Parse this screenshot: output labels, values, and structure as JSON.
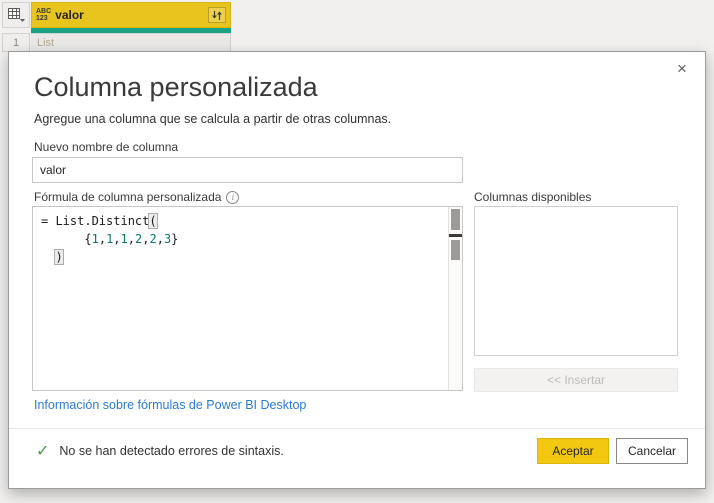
{
  "table": {
    "header": {
      "type_label_top": "ABC",
      "type_label_bottom": "123",
      "column_name": "valor"
    },
    "row": {
      "number": "1",
      "value": "List"
    }
  },
  "dialog": {
    "close_glyph": "×",
    "title": "Columna personalizada",
    "subtitle": "Agregue una columna que se calcula a partir de otras columnas.",
    "name_field": {
      "label": "Nuevo nombre de columna",
      "value": "valor"
    },
    "formula_field": {
      "label": "Fórmula de columna personalizada",
      "info_glyph": "i",
      "lines": [
        [
          {
            "t": "= ",
            "c": "p"
          },
          {
            "t": "List.Distinct",
            "c": "p"
          },
          {
            "t": "(",
            "c": "b"
          }
        ],
        [
          {
            "t": "      ",
            "c": "p"
          },
          {
            "t": "{",
            "c": "p"
          },
          {
            "t": "1",
            "c": "n"
          },
          {
            "t": ",",
            "c": "p"
          },
          {
            "t": "1",
            "c": "n"
          },
          {
            "t": ",",
            "c": "p"
          },
          {
            "t": "1",
            "c": "n"
          },
          {
            "t": ",",
            "c": "p"
          },
          {
            "t": "2",
            "c": "n"
          },
          {
            "t": ",",
            "c": "p"
          },
          {
            "t": "2",
            "c": "n"
          },
          {
            "t": ",",
            "c": "p"
          },
          {
            "t": "3",
            "c": "n"
          },
          {
            "t": "}",
            "c": "p"
          }
        ],
        [
          {
            "t": "  ",
            "c": "p"
          },
          {
            "t": ")",
            "c": "b"
          }
        ]
      ]
    },
    "available_columns": {
      "label": "Columnas disponibles",
      "items": []
    },
    "insert_button_label": "<< Insertar",
    "help_link": "Información sobre fórmulas de Power BI Desktop",
    "status": {
      "icon_glyph": "✓",
      "message": "No se han detectado errores de sintaxis."
    },
    "accept_button_label": "Aceptar",
    "cancel_button_label": "Cancelar"
  },
  "colors": {
    "header_yellow": "#e8c41e",
    "teal_accent": "#1ba184",
    "accept_yellow": "#f2c811",
    "link_blue": "#2b7bd3",
    "check_green": "#4a9e4a",
    "number_token_teal": "#0e7569"
  }
}
